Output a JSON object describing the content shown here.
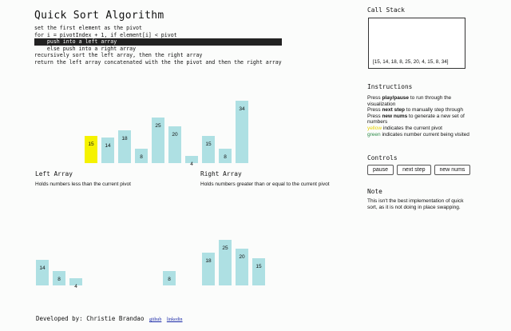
{
  "title": "Quick Sort Algorithm",
  "pseudocode": [
    "set the first element as the pivot",
    "for i = pivotIndex + 1, if element[i] < pivot",
    "    push into a left array",
    "    else push into a right array",
    "recursively sort the left array, then the right array",
    "return the left array concatenated with the the pivot and then the right array"
  ],
  "highlighted_line": 2,
  "main_array": [
    {
      "value": 15,
      "state": "pivot"
    },
    {
      "value": 14,
      "state": "normal"
    },
    {
      "value": 18,
      "state": "normal"
    },
    {
      "value": 8,
      "state": "normal"
    },
    {
      "value": 25,
      "state": "normal"
    },
    {
      "value": 20,
      "state": "normal"
    },
    {
      "value": 4,
      "state": "normal"
    },
    {
      "value": 15,
      "state": "normal"
    },
    {
      "value": 8,
      "state": "normal"
    },
    {
      "value": 34,
      "state": "normal"
    }
  ],
  "left_array": {
    "title": "Left Array",
    "description": "Holds numbers less than the current pivot",
    "values": [
      14,
      8,
      4
    ],
    "extra_values": [
      8
    ]
  },
  "right_array": {
    "title": "Right Array",
    "description": "Holds numbers greater than or equal to the current pivot",
    "values": [
      18,
      25,
      20,
      15
    ]
  },
  "call_stack": {
    "title": "Call Stack",
    "entries": [
      "[15, 14, 18, 8, 25, 20, 4, 15, 8, 34]"
    ]
  },
  "instructions": {
    "title": "Instructions",
    "press1": "Press",
    "play_pause": "play/pause",
    "press1_rest": "to run through the visualization",
    "press2": "Press",
    "next_step": "next step",
    "press2_rest": "to manually step through",
    "press3": "Press",
    "new_nums": "new nums",
    "press3_rest": "to generate a new set of numbers",
    "yellow_word": "yellow",
    "yellow_rest": "indicates the current pivot",
    "green_word": "green",
    "green_rest": "indicates number current being visited"
  },
  "controls": {
    "title": "Controls",
    "pause_label": "pause",
    "next_step_label": "next step",
    "new_nums_label": "new nums"
  },
  "note": {
    "title": "Note",
    "text": "This isn't the best implementation of quick sort, as it is not doing in place swapping."
  },
  "footer": {
    "developed_by": "Developed by: Christie Brandao",
    "github": "github",
    "linkedin": "linkedin"
  },
  "colors": {
    "bar": "#aee0e3",
    "pivot": "#f5f200",
    "visited": "#9ad7a8"
  }
}
